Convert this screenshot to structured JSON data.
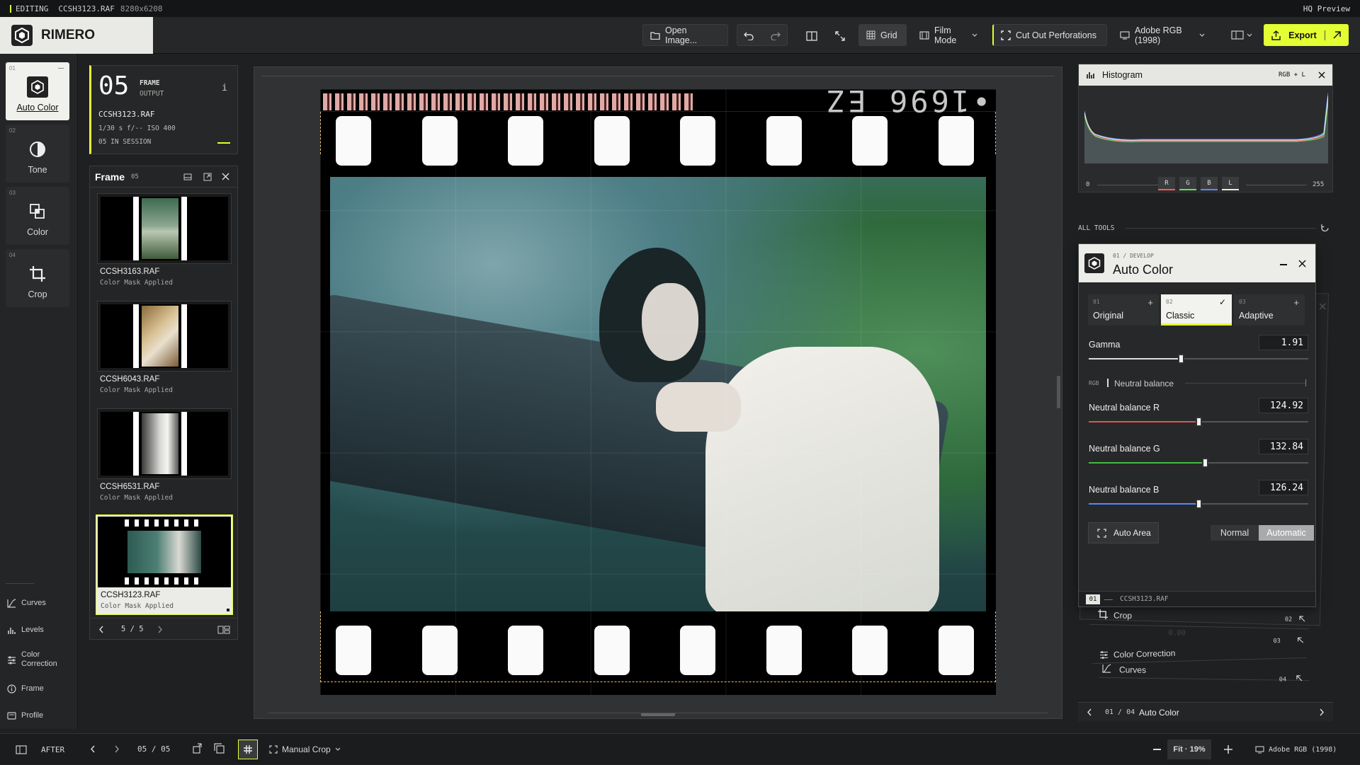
{
  "status": {
    "mode": "EDITING",
    "file": "CCSH3123.RAF",
    "resolution": "8280x6208",
    "right": "HQ Preview"
  },
  "app": {
    "name": "RIMERO"
  },
  "toolbar": {
    "open": "Open Image...",
    "grid": "Grid",
    "film_mode": "Film Mode",
    "cut": "Cut Out Perforations",
    "profile": "Adobe RGB (1998)",
    "export": "Export"
  },
  "rail": [
    {
      "num": "01",
      "label": "Auto Color",
      "icon": "auto-color-icon",
      "active": true
    },
    {
      "num": "02",
      "label": "Tone",
      "icon": "tone-icon"
    },
    {
      "num": "03",
      "label": "Color",
      "icon": "color-icon"
    },
    {
      "num": "04",
      "label": "Crop",
      "icon": "crop-icon"
    }
  ],
  "rail_tools": [
    {
      "label": "Curves"
    },
    {
      "label": "Levels"
    },
    {
      "label": "Color\nCorrection"
    },
    {
      "label": "Frame"
    },
    {
      "label": "Profile"
    }
  ],
  "frame_info": {
    "number": "05",
    "l1": "FRAME",
    "l2": "OUTPUT",
    "info": "i",
    "file": "CCSH3123.RAF",
    "exposure": "1/30 s f/-- ISO 400",
    "session": "05 IN SESSION"
  },
  "frame_panel": {
    "title": "Frame",
    "count": "05",
    "pager": "5 / 5",
    "items": [
      {
        "name": "CCSH3163.RAF",
        "status": "Color Mask Applied"
      },
      {
        "name": "CCSH6043.RAF",
        "status": "Color Mask Applied"
      },
      {
        "name": "CCSH6531.RAF",
        "status": "Color Mask Applied"
      },
      {
        "name": "CCSH3123.RAF",
        "status": "Color Mask Applied"
      }
    ]
  },
  "film": {
    "edge_text": "•1696 EZ"
  },
  "histogram": {
    "title": "Histogram",
    "mode": "RGB + L",
    "min": "0",
    "max": "255",
    "channels": [
      "R",
      "G",
      "B",
      "L"
    ],
    "colors": [
      "#ff5a5a",
      "#66dd66",
      "#5a8cff",
      "#e8e8e8"
    ]
  },
  "all_tools": "ALL TOOLS",
  "auto_color": {
    "breadcrumb": "01 / DEVELOP",
    "title": "Auto Color",
    "presets": [
      {
        "num": "01",
        "name": "Original",
        "mark": "+"
      },
      {
        "num": "02",
        "name": "Classic",
        "mark": "✓"
      },
      {
        "num": "03",
        "name": "Adaptive",
        "mark": "+"
      }
    ],
    "gamma": {
      "label": "Gamma",
      "value": "1.91",
      "position": 0.42
    },
    "section": {
      "prefix": "RGB",
      "label": "Neutral balance"
    },
    "r": {
      "label": "Neutral balance R",
      "value": "124.92",
      "position": 0.5
    },
    "g": {
      "label": "Neutral balance G",
      "value": "132.84",
      "position": 0.53
    },
    "b": {
      "label": "Neutral balance B",
      "value": "126.24",
      "position": 0.5
    },
    "auto_area": "Auto Area",
    "mode_normal": "Normal",
    "mode_auto": "Automatic",
    "footer_num": "01",
    "footer_file": "CCSH3123.RAF"
  },
  "stack": [
    {
      "label": "Crop",
      "num": "02",
      "value": "0.00"
    },
    {
      "label": "Color Correction",
      "num": "03"
    },
    {
      "label": "Curves",
      "num": "04"
    }
  ],
  "tool_nav": {
    "pager": "01 / 04",
    "current": "Auto Color"
  },
  "bottom": {
    "view": "AFTER",
    "pager": "05 / 05",
    "crop": "Manual Crop",
    "zoom": "Fit · 19%",
    "profile": "Adobe RGB (1998)"
  }
}
